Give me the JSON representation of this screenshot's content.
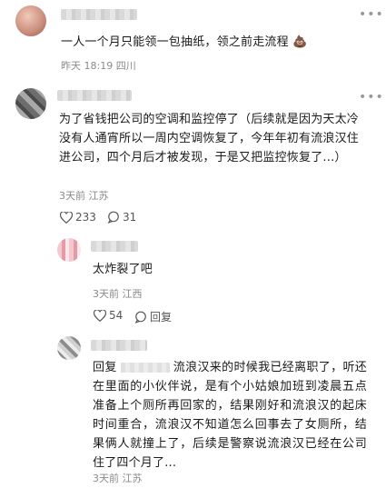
{
  "comment1": {
    "text": "一人一个月只能领一包抽纸，领之前走流程",
    "emoji": "💩",
    "time": "昨天 18:19",
    "location": "四川"
  },
  "comment2": {
    "text": "为了省钱把公司的空调和监控停了（后续就是因为天太冷没有人通宵所以一周内空调恢复了，今年年初有流浪汉住进公司，四个月后才被发现，于是又把监控恢复了...）",
    "time": "3天前",
    "location": "江苏",
    "likes": "233",
    "replies": "31",
    "reply1": {
      "text": "太炸裂了吧",
      "time": "3天前",
      "location": "江西",
      "likes": "54",
      "reply_label": "回复"
    },
    "reply2": {
      "prefix": "回复",
      "text": "流浪汉来的时候我已经离职了，听还在里面的小伙伴说，是有个小姑娘加班到凌晨五点准备上个厕所再回家的，结果刚好和流浪汉的起床时间重合，流浪汉不知道怎么回事去了女厕所，结果俩人就撞上了，后续是警察说流浪汉已经在公司住了四个月了...",
      "time": "3天前",
      "location": "江苏"
    }
  }
}
